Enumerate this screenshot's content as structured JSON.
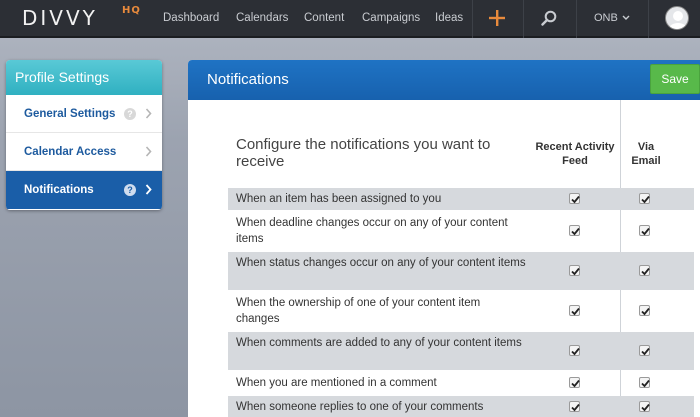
{
  "brand": {
    "logo": "DIVVY",
    "suffix": "HQ"
  },
  "nav": {
    "items": [
      "Dashboard",
      "Calendars",
      "Content",
      "Campaigns",
      "Ideas"
    ],
    "org": "ONB"
  },
  "sidebar": {
    "title": "Profile Settings",
    "items": [
      {
        "label": "General Settings",
        "help": "?"
      },
      {
        "label": "Calendar Access"
      },
      {
        "label": "Notifications",
        "help": "?"
      }
    ]
  },
  "panel": {
    "title": "Notifications",
    "save_label": "Save",
    "heading": "Configure the notifications you want to receive",
    "columns": {
      "feed": "Recent Activity Feed",
      "email": "Via Email"
    },
    "rows": [
      {
        "label": "When an item has been assigned to you",
        "feed": true,
        "email": true
      },
      {
        "label": "When deadline changes occur on any of your content items",
        "feed": true,
        "email": true
      },
      {
        "label": "When status changes occur on any of your content items",
        "feed": true,
        "email": true
      },
      {
        "label": "When the ownership of one of your content item changes",
        "feed": true,
        "email": true
      },
      {
        "label": "When comments are added to any of your content items",
        "feed": true,
        "email": true
      },
      {
        "label": "When you are mentioned in a comment",
        "feed": true,
        "email": true
      },
      {
        "label": "When someone replies to one of your comments",
        "feed": true,
        "email": true
      }
    ]
  },
  "colors": {
    "accent": "#1a5ea8",
    "teal": "#2fb0c1",
    "save": "#58b94a",
    "plus": "#e88a3c"
  },
  "icons": [
    "plus-icon",
    "search-icon",
    "chevron-down-icon",
    "avatar-icon",
    "help-icon",
    "chevron-right-icon",
    "checkbox-checked-icon"
  ]
}
